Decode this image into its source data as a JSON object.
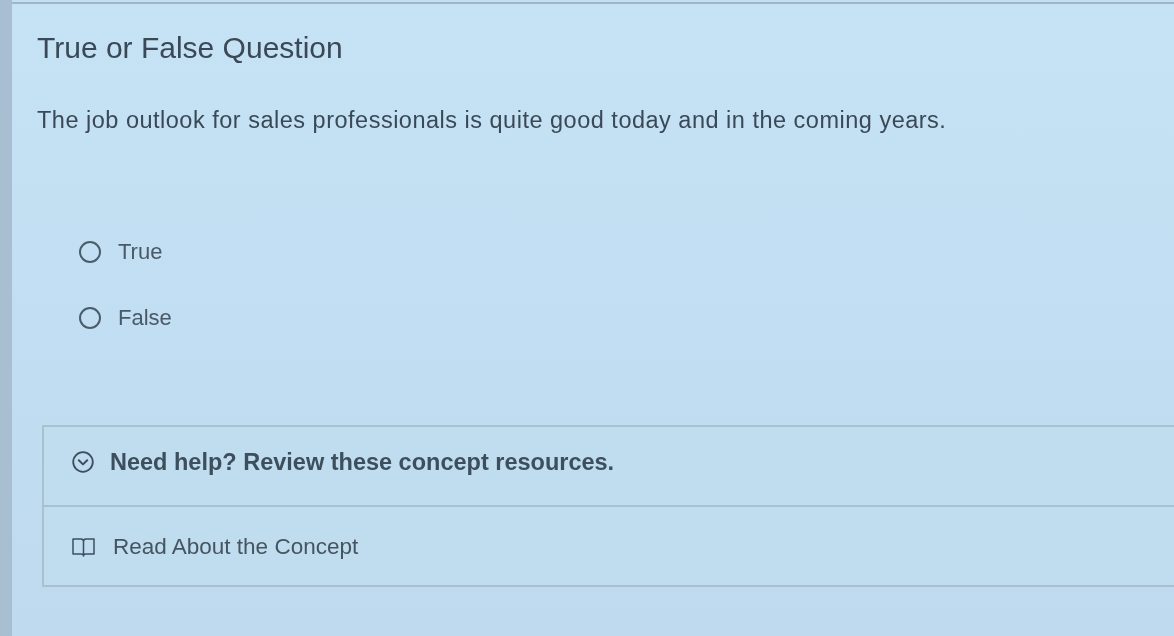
{
  "question": {
    "heading": "True or False Question",
    "prompt": "The job outlook for sales professionals is quite good today and in the coming years."
  },
  "options": [
    {
      "label": "True",
      "selected": false
    },
    {
      "label": "False",
      "selected": false
    }
  ],
  "help": {
    "heading": "Need help? Review these concept resources.",
    "expanded": true,
    "resources": [
      {
        "label": "Read About the Concept"
      }
    ]
  }
}
